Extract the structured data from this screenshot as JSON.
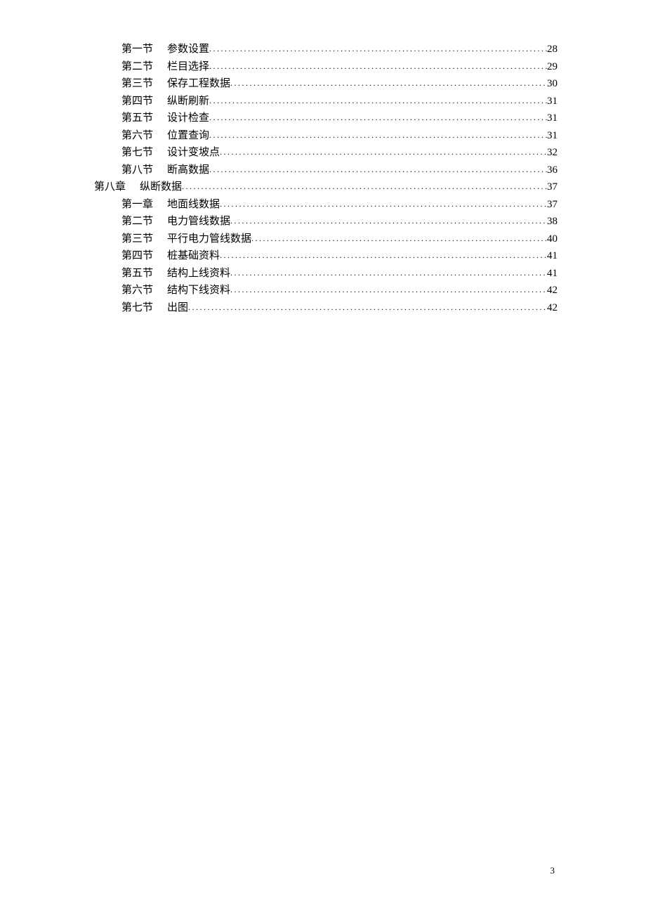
{
  "toc": [
    {
      "type": "section",
      "label": "第一节",
      "title": "参数设置",
      "page": "28"
    },
    {
      "type": "section",
      "label": "第二节",
      "title": "栏目选择",
      "page": "29"
    },
    {
      "type": "section",
      "label": "第三节",
      "title": "保存工程数据",
      "page": "30"
    },
    {
      "type": "section",
      "label": "第四节",
      "title": "纵断刷新",
      "page": "31"
    },
    {
      "type": "section",
      "label": "第五节",
      "title": "设计检查",
      "page": "31"
    },
    {
      "type": "section",
      "label": "第六节",
      "title": "位置查询",
      "page": "31"
    },
    {
      "type": "section",
      "label": "第七节",
      "title": "设计变坡点",
      "page": "32"
    },
    {
      "type": "section",
      "label": "第八节",
      "title": "断高数据",
      "page": "36"
    },
    {
      "type": "chapter",
      "label": "第八章",
      "title": "纵断数据",
      "page": "37"
    },
    {
      "type": "section",
      "label": "第一章",
      "title": "地面线数据",
      "page": "37"
    },
    {
      "type": "section",
      "label": "第二节",
      "title": "电力管线数据",
      "page": "38"
    },
    {
      "type": "section",
      "label": "第三节",
      "title": "平行电力管线数据",
      "page": "40"
    },
    {
      "type": "section",
      "label": "第四节",
      "title": "桩基础资料",
      "page": "41"
    },
    {
      "type": "section",
      "label": "第五节",
      "title": "结构上线资料",
      "page": "41"
    },
    {
      "type": "section",
      "label": "第六节",
      "title": "结构下线资料",
      "page": "42"
    },
    {
      "type": "section",
      "label": "第七节",
      "title": "出图",
      "page": "42"
    }
  ],
  "footer_page": "3"
}
